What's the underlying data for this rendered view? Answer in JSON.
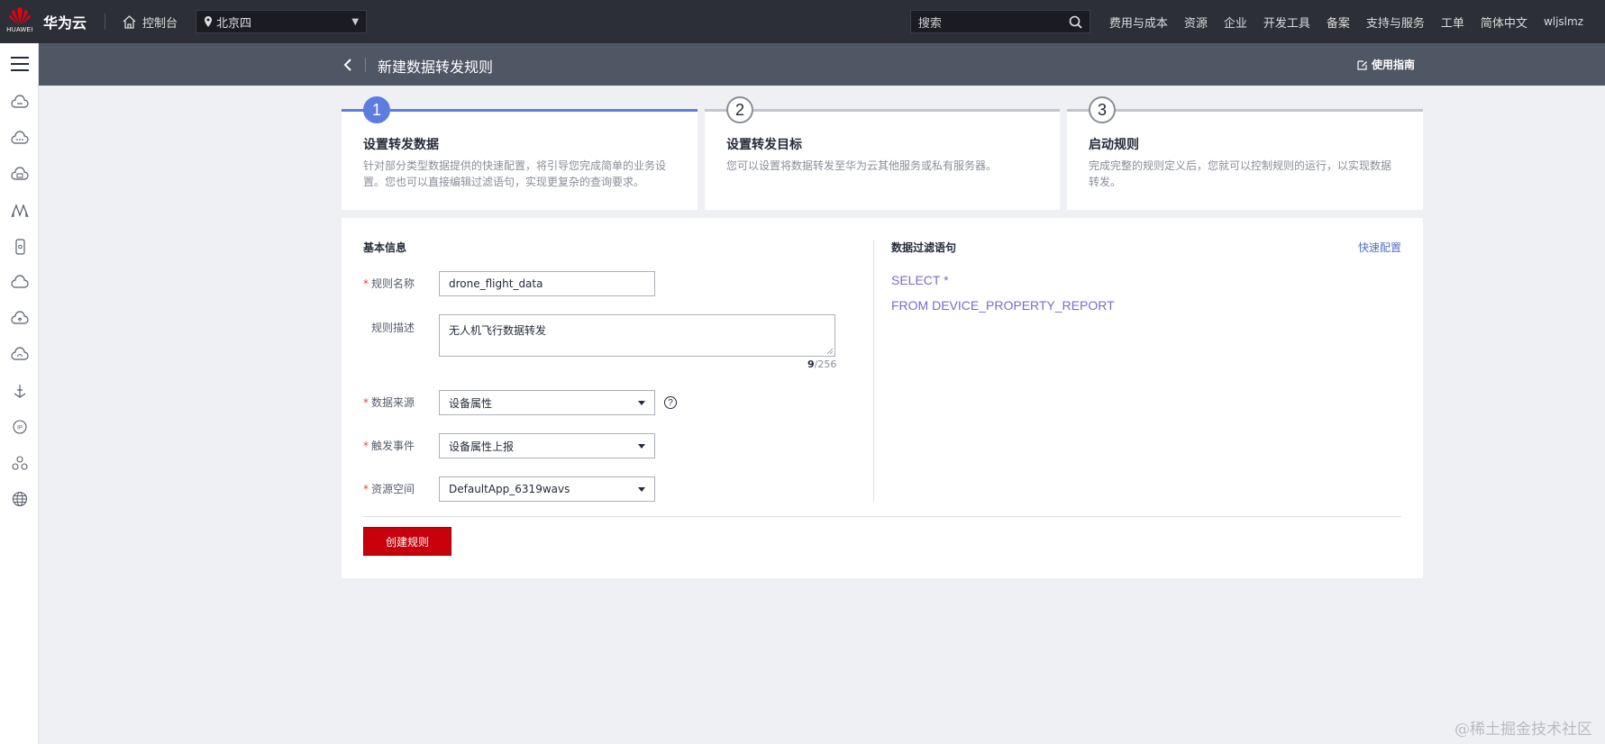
{
  "topbar": {
    "brand": "华为云",
    "logo_text": "HUAWEI",
    "console": "控制台",
    "region": "北京四",
    "search_placeholder": "搜索",
    "nav": [
      "费用与成本",
      "资源",
      "企业",
      "开发工具",
      "备案",
      "支持与服务",
      "工单",
      "简体中文"
    ],
    "user": "wljslmz"
  },
  "sidebar": {
    "icons": [
      "cloud-server-icon",
      "cloud-dots-icon",
      "cloud-box-icon",
      "bridge-icon",
      "phone-icon",
      "cloud-outline-icon",
      "cloud-upload-icon",
      "cloud-sync-icon",
      "anchor-icon",
      "ip-icon",
      "network-icon",
      "globe-icon"
    ]
  },
  "subheader": {
    "title": "新建数据转发规则",
    "guide": "使用指南"
  },
  "steps": [
    {
      "number": "1",
      "title": "设置转发数据",
      "desc": "针对部分类型数据提供的快速配置，将引导您完成简单的业务设置。您也可以直接编辑过滤语句，实现更复杂的查询要求。",
      "active": true
    },
    {
      "number": "2",
      "title": "设置转发目标",
      "desc": "您可以设置将数据转发至华为云其他服务或私有服务器。",
      "active": false
    },
    {
      "number": "3",
      "title": "启动规则",
      "desc": "完成完整的规则定义后，您就可以控制规则的运行，以实现数据转发。",
      "active": false
    }
  ],
  "form": {
    "section_title": "基本信息",
    "required_mark": "*",
    "rule_name_label": "规则名称",
    "rule_name_value": "drone_flight_data",
    "desc_label": "规则描述",
    "desc_value": "无人机飞行数据转发",
    "desc_count": "9",
    "desc_max": "/256",
    "source_label": "数据来源",
    "source_value": "设备属性",
    "help": "?",
    "trigger_label": "触发事件",
    "trigger_value": "设备属性上报",
    "space_label": "资源空间",
    "space_value": "DefaultApp_6319wavs",
    "create_button": "创建规则"
  },
  "filter": {
    "title": "数据过滤语句",
    "quick_config": "快速配置",
    "sql_line1": "SELECT *",
    "sql_line2": "FROM DEVICE_PROPERTY_REPORT"
  },
  "watermark": "@稀土掘金技术社区"
}
